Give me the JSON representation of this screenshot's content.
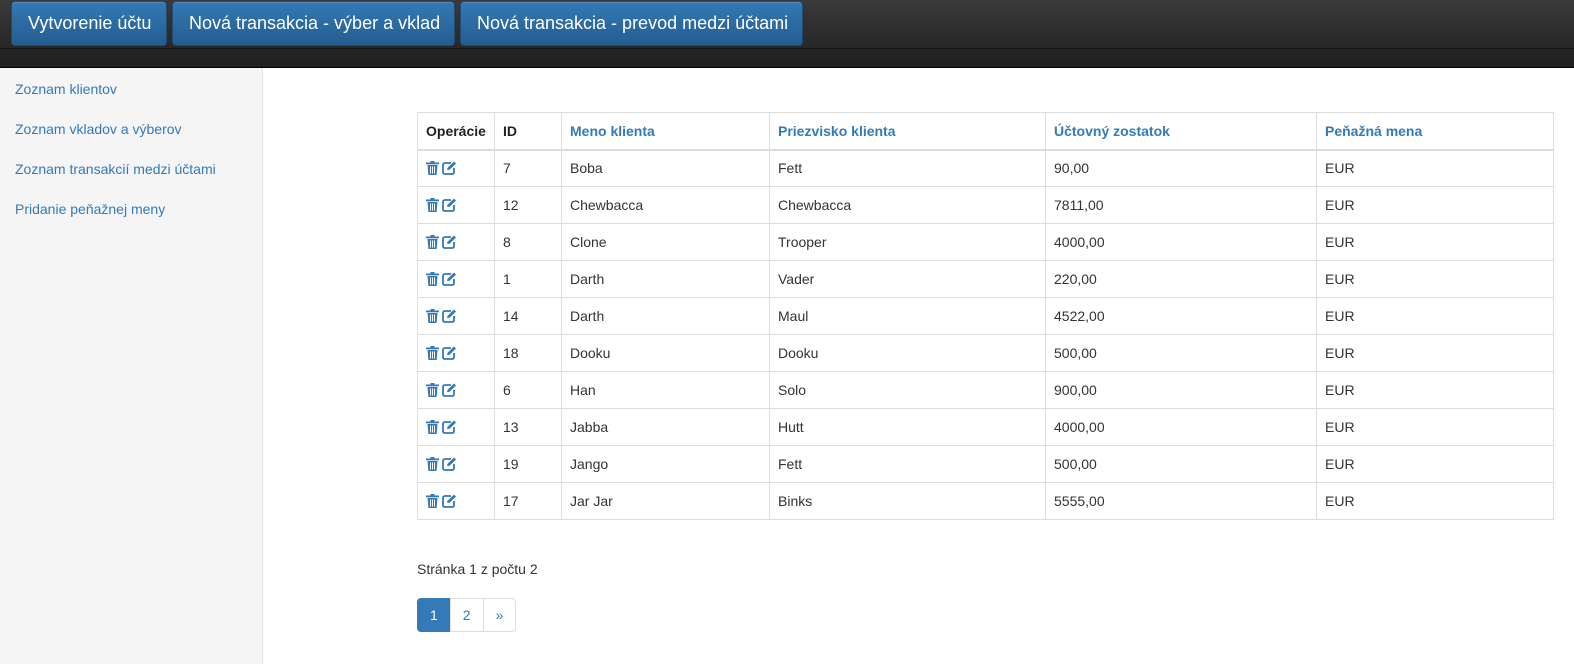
{
  "topnav": {
    "create_account": "Vytvorenie účtu",
    "new_tx_withdraw_deposit": "Nová transakcia - výber a vklad",
    "new_tx_transfer": "Nová transakcia - prevod medzi účtami"
  },
  "sidebar": {
    "items": [
      {
        "label": "Zoznam klientov"
      },
      {
        "label": "Zoznam vkladov a výberov"
      },
      {
        "label": "Zoznam transakcií medzi účtami"
      },
      {
        "label": "Pridanie peňažnej meny"
      }
    ]
  },
  "table": {
    "headers": {
      "ops": "Operácie",
      "id": "ID",
      "first_name": "Meno klienta",
      "last_name": "Priezvisko klienta",
      "balance": "Účtovný zostatok",
      "currency": "Peňažná mena"
    },
    "operation_icons": [
      "trash-icon",
      "edit-icon"
    ],
    "rows": [
      {
        "id": "7",
        "first_name": "Boba",
        "last_name": "Fett",
        "balance": "90,00",
        "currency": "EUR"
      },
      {
        "id": "12",
        "first_name": "Chewbacca",
        "last_name": "Chewbacca",
        "balance": "7811,00",
        "currency": "EUR"
      },
      {
        "id": "8",
        "first_name": "Clone",
        "last_name": "Trooper",
        "balance": "4000,00",
        "currency": "EUR"
      },
      {
        "id": "1",
        "first_name": "Darth",
        "last_name": "Vader",
        "balance": "220,00",
        "currency": "EUR"
      },
      {
        "id": "14",
        "first_name": "Darth",
        "last_name": "Maul",
        "balance": "4522,00",
        "currency": "EUR"
      },
      {
        "id": "18",
        "first_name": "Dooku",
        "last_name": "Dooku",
        "balance": "500,00",
        "currency": "EUR"
      },
      {
        "id": "6",
        "first_name": "Han",
        "last_name": "Solo",
        "balance": "900,00",
        "currency": "EUR"
      },
      {
        "id": "13",
        "first_name": "Jabba",
        "last_name": "Hutt",
        "balance": "4000,00",
        "currency": "EUR"
      },
      {
        "id": "19",
        "first_name": "Jango",
        "last_name": "Fett",
        "balance": "500,00",
        "currency": "EUR"
      },
      {
        "id": "17",
        "first_name": "Jar Jar",
        "last_name": "Binks",
        "balance": "5555,00",
        "currency": "EUR"
      }
    ]
  },
  "pagination": {
    "info": "Stránka 1 z počtu 2",
    "pages": [
      "1",
      "2"
    ],
    "next": "»",
    "active": "1"
  },
  "colors": {
    "accent": "#337ab7",
    "topbar": "#222222",
    "sidebar_bg": "#f5f5f5"
  }
}
